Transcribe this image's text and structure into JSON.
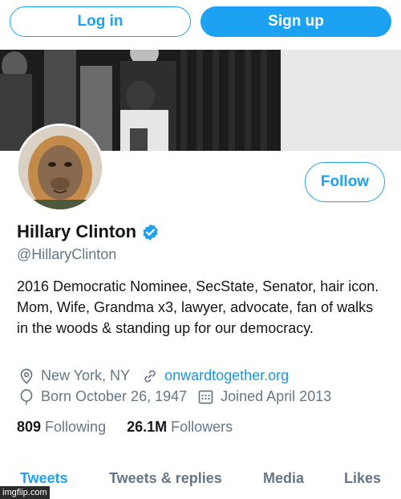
{
  "header": {
    "login_label": "Log in",
    "signup_label": "Sign up"
  },
  "profile": {
    "display_name": "Hillary Clinton",
    "handle": "@HillaryClinton",
    "follow_label": "Follow",
    "bio": "2016 Democratic Nominee, SecState, Senator, hair icon. Mom, Wife, Grandma x3, lawyer, advocate, fan of walks in the woods & standing up for our democracy.",
    "location": "New York, NY",
    "website": "onwardtogether.org",
    "born": "Born October 26, 1947",
    "joined": "Joined April 2013"
  },
  "stats": {
    "following_count": "809",
    "following_label": "Following",
    "followers_count": "26.1M",
    "followers_label": "Followers"
  },
  "tabs": [
    {
      "label": "Tweets",
      "active": true
    },
    {
      "label": "Tweets & replies",
      "active": false
    },
    {
      "label": "Media",
      "active": false
    },
    {
      "label": "Likes",
      "active": false
    }
  ],
  "watermark": "imgflip.com",
  "colors": {
    "accent": "#1da1f2",
    "link": "#1b95e0",
    "muted": "#657786",
    "text": "#14171a"
  },
  "icons": {
    "verified": "verified-badge-icon",
    "location": "location-pin-icon",
    "link": "link-icon",
    "birthday": "balloon-icon",
    "joined": "calendar-icon"
  }
}
